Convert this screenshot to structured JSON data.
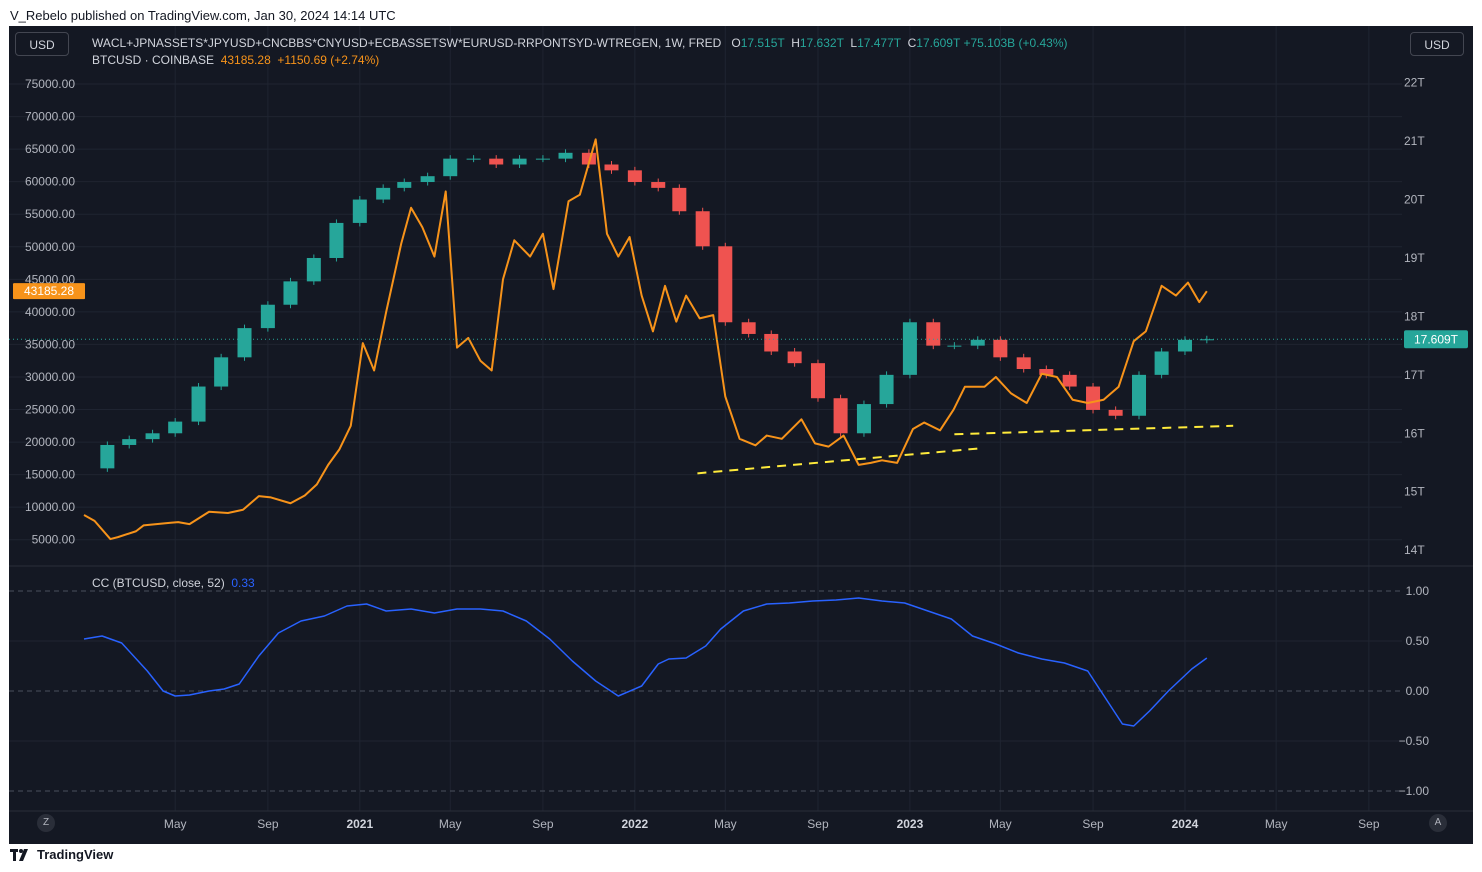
{
  "publisher": "V_Rebelo published on TradingView.com, Jan 30, 2024 14:14 UTC",
  "brand": "TradingView",
  "currency_left": "USD",
  "currency_right": "USD",
  "zoom_left": "Z",
  "zoom_right": "A",
  "legend": {
    "series1_name": "WACL+JPNASSETS*JPYUSD+CNCBBS*CNYUSD+ECBASSETSW*EURUSD-RRPONTSYD-WTREGEN, 1W, FRED",
    "o_label": "O",
    "o_value": "17.515T",
    "h_label": "H",
    "h_value": "17.632T",
    "l_label": "L",
    "l_value": "17.477T",
    "c_label": "C",
    "c_value": "17.609T",
    "change": "+75.103B (+0.43%)",
    "series2_name": "BTCUSD · COINBASE",
    "btc_value": "43185.28",
    "btc_change": "+1150.69 (+2.74%)",
    "cc_name": "CC (BTCUSD, close, 52)",
    "cc_value": "0.33"
  },
  "colors": {
    "background": "#141823",
    "grid": "#1f2431",
    "text": "#b2b5be",
    "up": "#26a69a",
    "down": "#ef5350",
    "btc": "#f7931a",
    "cc": "#2962ff",
    "support": "#ffeb3b"
  },
  "chart_data": [
    {
      "type": "line",
      "name": "BTCUSD · COINBASE",
      "axis": "left",
      "x": [
        "2020-01-01",
        "2020-01-15",
        "2020-02-05",
        "2020-02-15",
        "2020-03-10",
        "2020-03-20",
        "2020-04-25",
        "2020-05-05",
        "2020-05-20",
        "2020-06-15",
        "2020-07-10",
        "2020-07-30",
        "2020-08-20",
        "2020-09-05",
        "2020-10-01",
        "2020-10-20",
        "2020-11-05",
        "2020-11-20",
        "2020-12-05",
        "2020-12-20",
        "2021-01-05",
        "2021-01-20",
        "2021-02-05",
        "2021-02-25",
        "2021-03-10",
        "2021-03-25",
        "2021-04-10",
        "2021-04-25",
        "2021-05-10",
        "2021-05-25",
        "2021-06-10",
        "2021-06-25",
        "2021-07-10",
        "2021-07-25",
        "2021-08-15",
        "2021-09-01",
        "2021-09-15",
        "2021-10-05",
        "2021-10-20",
        "2021-11-10",
        "2021-11-25",
        "2021-12-10",
        "2021-12-25",
        "2022-01-10",
        "2022-01-25",
        "2022-02-10",
        "2022-02-25",
        "2022-03-10",
        "2022-03-28",
        "2022-04-15",
        "2022-05-01",
        "2022-05-20",
        "2022-06-10",
        "2022-06-25",
        "2022-07-15",
        "2022-08-10",
        "2022-08-28",
        "2022-09-15",
        "2022-10-05",
        "2022-10-25",
        "2022-11-10",
        "2022-11-25",
        "2022-12-15",
        "2023-01-05",
        "2023-01-20",
        "2023-02-10",
        "2023-02-28",
        "2023-03-15",
        "2023-04-10",
        "2023-04-25",
        "2023-05-15",
        "2023-06-05",
        "2023-06-25",
        "2023-07-15",
        "2023-08-05",
        "2023-08-25",
        "2023-09-15",
        "2023-10-05",
        "2023-10-25",
        "2023-11-10",
        "2023-12-01",
        "2023-12-20",
        "2024-01-05",
        "2024-01-20",
        "2024-01-30"
      ],
      "values": [
        8800,
        7900,
        5100,
        5400,
        6300,
        7200,
        7600,
        7700,
        7400,
        9300,
        9100,
        9600,
        11700,
        11500,
        10600,
        11800,
        13500,
        16500,
        18900,
        22500,
        35200,
        31000,
        40000,
        50500,
        56000,
        53000,
        48500,
        58500,
        34500,
        36000,
        32500,
        31000,
        45000,
        51000,
        48500,
        52000,
        43500,
        57000,
        58000,
        66500,
        52000,
        48500,
        51500,
        42500,
        37000,
        44000,
        38500,
        42500,
        39000,
        39500,
        27000,
        20500,
        19500,
        21000,
        20500,
        23500,
        19800,
        19300,
        21000,
        16500,
        16800,
        17200,
        16800,
        22000,
        23000,
        21800,
        25000,
        28500,
        28500,
        30000,
        27500,
        26000,
        30500,
        30000,
        26500,
        26000,
        26500,
        28500,
        35500,
        37000,
        44000,
        42500,
        44500,
        41500,
        43185.28
      ]
    },
    {
      "type": "candlestick",
      "name": "WACL+JPNASSETS*JPYUSD+CNCBBS*CNYUSD+ECBASSETSW*EURUSD-RRPONTSYD-WTREGEN",
      "axis": "right",
      "unit": "T",
      "x": [
        "2020-01-01",
        "2020-02-01",
        "2020-03-01",
        "2020-04-01",
        "2020-05-01",
        "2020-06-01",
        "2020-07-01",
        "2020-08-01",
        "2020-09-01",
        "2020-10-01",
        "2020-11-01",
        "2020-12-01",
        "2021-01-01",
        "2021-02-01",
        "2021-03-01",
        "2021-04-01",
        "2021-05-01",
        "2021-06-01",
        "2021-07-01",
        "2021-08-01",
        "2021-09-01",
        "2021-10-01",
        "2021-11-01",
        "2021-12-01",
        "2022-01-01",
        "2022-02-01",
        "2022-03-01",
        "2022-04-01",
        "2022-05-01",
        "2022-06-01",
        "2022-07-01",
        "2022-08-01",
        "2022-09-01",
        "2022-10-01",
        "2022-11-01",
        "2022-12-01",
        "2023-01-01",
        "2023-02-01",
        "2023-03-01",
        "2023-04-01",
        "2023-05-01",
        "2023-06-01",
        "2023-07-01",
        "2023-08-01",
        "2023-09-01",
        "2023-10-01",
        "2023-11-01",
        "2023-12-01",
        "2024-01-01",
        "2024-01-30"
      ],
      "values": [
        15.4,
        15.8,
        15.9,
        16.0,
        16.2,
        16.8,
        17.3,
        17.8,
        18.2,
        18.6,
        19.0,
        19.6,
        20.0,
        20.2,
        20.3,
        20.4,
        20.7,
        20.7,
        20.6,
        20.7,
        20.7,
        20.8,
        20.6,
        20.5,
        20.3,
        20.2,
        19.8,
        19.2,
        17.9,
        17.7,
        17.4,
        17.2,
        16.6,
        16.0,
        16.5,
        17.0,
        17.9,
        17.5,
        17.5,
        17.6,
        17.3,
        17.1,
        17.0,
        16.8,
        16.4,
        16.3,
        17.0,
        17.4,
        17.6,
        17.609
      ]
    },
    {
      "type": "line",
      "name": "CC (BTCUSD, close, 52)",
      "axis": "cc",
      "x": [
        "2020-01-01",
        "2020-01-25",
        "2020-02-20",
        "2020-03-25",
        "2020-04-15",
        "2020-05-01",
        "2020-05-20",
        "2020-06-15",
        "2020-07-05",
        "2020-07-25",
        "2020-08-20",
        "2020-09-15",
        "2020-10-15",
        "2020-11-15",
        "2020-12-15",
        "2021-01-10",
        "2021-02-05",
        "2021-03-10",
        "2021-04-10",
        "2021-05-10",
        "2021-06-10",
        "2021-07-10",
        "2021-08-10",
        "2021-09-10",
        "2021-10-10",
        "2021-11-10",
        "2021-12-10",
        "2022-01-10",
        "2022-02-01",
        "2022-02-15",
        "2022-03-10",
        "2022-04-05",
        "2022-04-25",
        "2022-05-25",
        "2022-06-25",
        "2022-07-25",
        "2022-08-25",
        "2022-09-25",
        "2022-10-25",
        "2022-11-25",
        "2022-12-25",
        "2023-01-25",
        "2023-02-25",
        "2023-03-25",
        "2023-04-25",
        "2023-05-25",
        "2023-06-25",
        "2023-07-25",
        "2023-08-25",
        "2023-09-20",
        "2023-10-10",
        "2023-10-25",
        "2023-11-15",
        "2023-12-10",
        "2024-01-10",
        "2024-01-30"
      ],
      "values": [
        0.52,
        0.55,
        0.48,
        0.2,
        0.0,
        -0.05,
        -0.04,
        0.0,
        0.02,
        0.07,
        0.35,
        0.58,
        0.7,
        0.75,
        0.85,
        0.87,
        0.8,
        0.82,
        0.78,
        0.82,
        0.82,
        0.8,
        0.7,
        0.52,
        0.3,
        0.1,
        -0.05,
        0.05,
        0.27,
        0.32,
        0.33,
        0.45,
        0.62,
        0.8,
        0.87,
        0.88,
        0.9,
        0.91,
        0.93,
        0.9,
        0.88,
        0.8,
        0.72,
        0.55,
        0.47,
        0.38,
        0.32,
        0.28,
        0.2,
        -0.1,
        -0.33,
        -0.35,
        -0.2,
        0.0,
        0.22,
        0.33
      ]
    },
    {
      "type": "line",
      "name": "support-1",
      "axis": "left",
      "style": "dashed",
      "x": [
        "2022-03-25",
        "2023-04-01"
      ],
      "values": [
        15200,
        19000
      ]
    },
    {
      "type": "line",
      "name": "support-2",
      "axis": "left",
      "style": "dashed",
      "x": [
        "2023-03-01",
        "2024-03-05"
      ],
      "values": [
        21200,
        22500
      ]
    }
  ],
  "axes": {
    "x_range": [
      "2020-01-01",
      "2024-10-15"
    ],
    "x_ticks": [
      {
        "date": "2020-05-01",
        "label": "May",
        "bold": false
      },
      {
        "date": "2020-09-01",
        "label": "Sep",
        "bold": false
      },
      {
        "date": "2021-01-01",
        "label": "2021",
        "bold": true
      },
      {
        "date": "2021-05-01",
        "label": "May",
        "bold": false
      },
      {
        "date": "2021-09-01",
        "label": "Sep",
        "bold": false
      },
      {
        "date": "2022-01-01",
        "label": "2022",
        "bold": true
      },
      {
        "date": "2022-05-01",
        "label": "May",
        "bold": false
      },
      {
        "date": "2022-09-01",
        "label": "Sep",
        "bold": false
      },
      {
        "date": "2023-01-01",
        "label": "2023",
        "bold": true
      },
      {
        "date": "2023-05-01",
        "label": "May",
        "bold": false
      },
      {
        "date": "2023-09-01",
        "label": "Sep",
        "bold": false
      },
      {
        "date": "2024-01-01",
        "label": "2024",
        "bold": true
      },
      {
        "date": "2024-05-01",
        "label": "May",
        "bold": false
      },
      {
        "date": "2024-09-01",
        "label": "Sep",
        "bold": false
      }
    ],
    "left": {
      "range": [
        2500,
        77000
      ],
      "ticks": [
        5000,
        10000,
        15000,
        20000,
        25000,
        30000,
        35000,
        40000,
        45000,
        50000,
        55000,
        60000,
        65000,
        70000,
        75000
      ],
      "labels": [
        "5000.00",
        "10000.00",
        "15000.00",
        "20000.00",
        "25000.00",
        "30000.00",
        "35000.00",
        "40000.00",
        "45000.00",
        "50000.00",
        "55000.00",
        "60000.00",
        "65000.00",
        "70000.00",
        "75000.00"
      ],
      "badge_value": 43185.28,
      "badge_label": "43185.28"
    },
    "right": {
      "range": [
        13.9,
        22.2
      ],
      "ticks": [
        14,
        15,
        16,
        17,
        18,
        19,
        20,
        21,
        22
      ],
      "labels": [
        "14T",
        "15T",
        "16T",
        "17T",
        "18T",
        "19T",
        "20T",
        "21T",
        "22T"
      ],
      "badge_value": 17.609,
      "badge_label": "17.609T"
    },
    "cc": {
      "range": [
        -1.05,
        1.05
      ],
      "ticks": [
        1,
        0.5,
        0,
        -0.5,
        -1
      ],
      "labels": [
        "1.00",
        "0.50",
        "0.00",
        "−0.50",
        "−1.00"
      ],
      "dashed": [
        1,
        0,
        -1
      ]
    }
  }
}
